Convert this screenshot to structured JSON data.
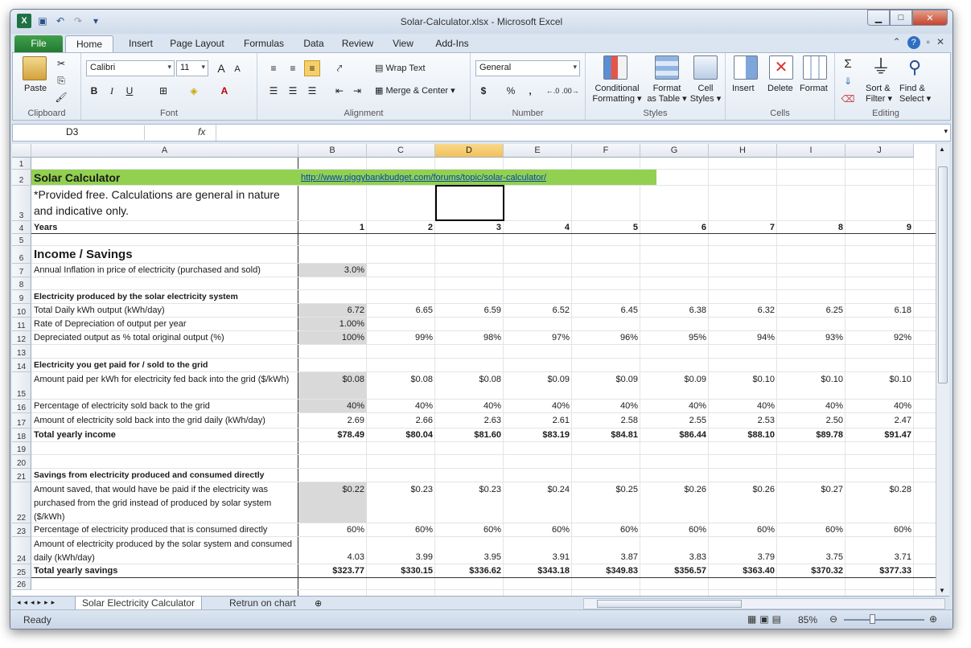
{
  "window": {
    "title": "Solar-Calculator.xlsx - Microsoft Excel"
  },
  "tabs": [
    "File",
    "Home",
    "Insert",
    "Page Layout",
    "Formulas",
    "Data",
    "Review",
    "View",
    "Add-Ins"
  ],
  "ribbon": {
    "clipboard": {
      "label": "Clipboard",
      "paste": "Paste"
    },
    "font": {
      "label": "Font",
      "name": "Calibri",
      "size": "11",
      "bold": "B",
      "italic": "I",
      "underline": "U"
    },
    "alignment": {
      "label": "Alignment",
      "wrap": "Wrap Text",
      "merge": "Merge & Center"
    },
    "number": {
      "label": "Number",
      "format": "General",
      "currency": "$",
      "percent": "%",
      "comma": ","
    },
    "styles": {
      "label": "Styles",
      "conditional": "Conditional",
      "conditional2": "Formatting",
      "format_table": "Format",
      "format_table2": "as Table",
      "cell_styles": "Cell",
      "cell_styles2": "Styles"
    },
    "cells": {
      "label": "Cells",
      "insert": "Insert",
      "delete": "Delete",
      "format": "Format"
    },
    "editing": {
      "label": "Editing",
      "sort": "Sort &",
      "sort2": "Filter",
      "find": "Find &",
      "find2": "Select",
      "sigma": "Σ"
    }
  },
  "formula_bar": {
    "name_box": "D3",
    "fx": "fx",
    "content": ""
  },
  "columns": [
    "A",
    "B",
    "C",
    "D",
    "E",
    "F",
    "G",
    "H",
    "I",
    "J"
  ],
  "rows": [
    {
      "n": "1",
      "h": 15,
      "cells": []
    },
    {
      "n": "2",
      "h": 20,
      "cells": [
        "Solar Calculator",
        "http://www.piggybankbudget.com/forums/topic/solar-calculator/"
      ]
    },
    {
      "n": "3",
      "h": 44,
      "cells": [
        "*Provided free. Calculations are general in nature and indicative only."
      ]
    },
    {
      "n": "4",
      "h": 16,
      "cells": [
        "Years",
        "1",
        "2",
        "3",
        "4",
        "5",
        "6",
        "7",
        "8",
        "9"
      ]
    },
    {
      "n": "5",
      "h": 15,
      "cells": []
    },
    {
      "n": "6",
      "h": 22,
      "cells": [
        "Income / Savings"
      ]
    },
    {
      "n": "7",
      "h": 17,
      "cells": [
        "Annual Inflation in price of electricity (purchased and sold)",
        "3.0%"
      ]
    },
    {
      "n": "8",
      "h": 16,
      "cells": []
    },
    {
      "n": "9",
      "h": 17,
      "cells": [
        "Electricity produced by the solar electricity system"
      ]
    },
    {
      "n": "10",
      "h": 17,
      "cells": [
        "Total Daily kWh output (kWh/day)",
        "6.72",
        "6.65",
        "6.59",
        "6.52",
        "6.45",
        "6.38",
        "6.32",
        "6.25",
        "6.18"
      ]
    },
    {
      "n": "11",
      "h": 17,
      "cells": [
        "Rate of Depreciation of output per year",
        "1.00%"
      ]
    },
    {
      "n": "12",
      "h": 17,
      "cells": [
        "Depreciated output as % total original output (%)",
        "100%",
        "99%",
        "98%",
        "97%",
        "96%",
        "95%",
        "94%",
        "93%",
        "92%"
      ]
    },
    {
      "n": "13",
      "h": 17,
      "cells": []
    },
    {
      "n": "14",
      "h": 17,
      "cells": [
        "Electricity you get paid for / sold to the grid"
      ]
    },
    {
      "n": "15",
      "h": 34,
      "cells": [
        "Amount paid per kWh for electricity fed back into the grid ($/kWh)",
        "$0.08",
        "$0.08",
        "$0.08",
        "$0.09",
        "$0.09",
        "$0.09",
        "$0.10",
        "$0.10",
        "$0.10"
      ]
    },
    {
      "n": "16",
      "h": 17,
      "cells": [
        "Percentage of electricity sold back to the grid",
        "40%",
        "40%",
        "40%",
        "40%",
        "40%",
        "40%",
        "40%",
        "40%",
        "40%"
      ]
    },
    {
      "n": "17",
      "h": 19,
      "cells": [
        "Amount of electricity sold back into the grid daily (kWh/day)",
        "2.69",
        "2.66",
        "2.63",
        "2.61",
        "2.58",
        "2.55",
        "2.53",
        "2.50",
        "2.47"
      ]
    },
    {
      "n": "18",
      "h": 17,
      "cells": [
        "Total yearly income",
        "$78.49",
        "$80.04",
        "$81.60",
        "$83.19",
        "$84.81",
        "$86.44",
        "$88.10",
        "$89.78",
        "$91.47"
      ]
    },
    {
      "n": "19",
      "h": 16,
      "cells": []
    },
    {
      "n": "20",
      "h": 17,
      "cells": []
    },
    {
      "n": "21",
      "h": 17,
      "cells": [
        "Savings from electricity produced and consumed directly"
      ]
    },
    {
      "n": "22",
      "h": 51,
      "cells": [
        "Amount saved, that would have be paid if the electricity was purchased from the grid instead of produced by solar system ($/kWh)",
        "$0.22",
        "$0.23",
        "$0.23",
        "$0.24",
        "$0.25",
        "$0.26",
        "$0.26",
        "$0.27",
        "$0.28"
      ]
    },
    {
      "n": "23",
      "h": 17,
      "cells": [
        "Percentage of electricity produced that is consumed directly",
        "60%",
        "60%",
        "60%",
        "60%",
        "60%",
        "60%",
        "60%",
        "60%",
        "60%"
      ]
    },
    {
      "n": "24",
      "h": 34,
      "cells": [
        "Amount of electricity produced by the solar system and consumed daily (kWh/day)",
        "4.03",
        "3.99",
        "3.95",
        "3.91",
        "3.87",
        "3.83",
        "3.79",
        "3.75",
        "3.71"
      ]
    },
    {
      "n": "25",
      "h": 17,
      "cells": [
        "Total yearly savings",
        "$323.77",
        "$330.15",
        "$336.62",
        "$343.18",
        "$349.83",
        "$356.57",
        "$363.40",
        "$370.32",
        "$377.33"
      ]
    },
    {
      "n": "26",
      "h": 15,
      "cells": []
    }
  ],
  "sheets": [
    "Solar Electricity Calculator",
    "Retrun on chart"
  ],
  "status": {
    "ready": "Ready",
    "zoom": "85%"
  }
}
